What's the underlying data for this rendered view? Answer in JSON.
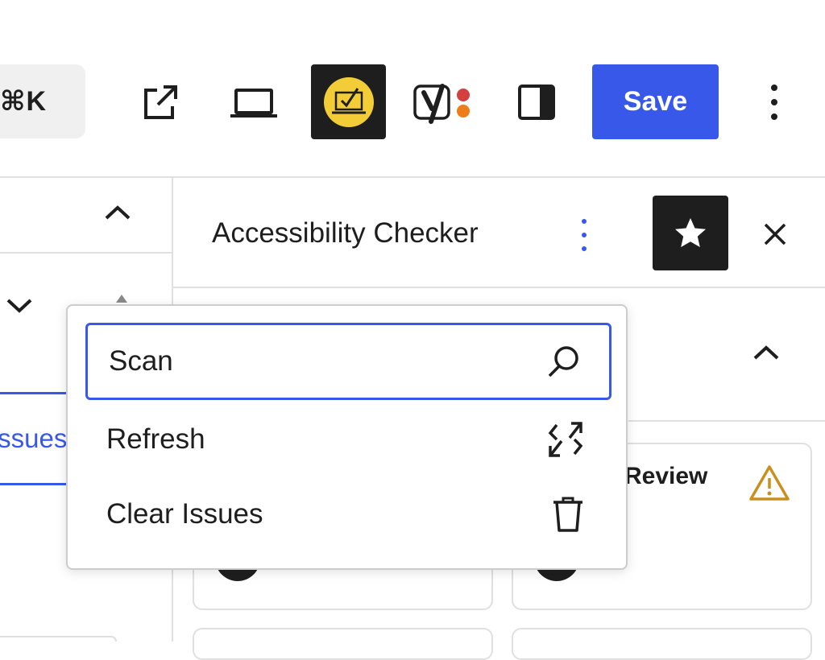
{
  "toolbar": {
    "shortcut_label": "⌘K",
    "save_label": "Save",
    "icons": {
      "view_post": "external-link-icon",
      "preview_device": "laptop-icon",
      "accessibility_checker": "accessibility-checker-icon",
      "yoast": "yoast-seo-icon",
      "settings": "sidebar-toggle-icon",
      "options": "more-vertical-icon"
    }
  },
  "sidebar": {
    "title": "Accessibility Checker",
    "icons": {
      "panel_menu": "more-vertical-icon",
      "pin": "star-icon",
      "close": "close-icon"
    }
  },
  "left_panel": {
    "active_tab_label": "Issues"
  },
  "cards": {
    "review_label": "Review"
  },
  "dropdown_menu": {
    "items": [
      {
        "label": "Scan",
        "icon": "search-icon"
      },
      {
        "label": "Refresh",
        "icon": "refresh-icon"
      },
      {
        "label": "Clear Issues",
        "icon": "trash-icon"
      }
    ]
  },
  "colors": {
    "accent": "#3858e9",
    "dark": "#1e1e1e",
    "a11y_badge": "#f3cd38",
    "warning": "#b26200",
    "yoast_red": "#d43f3f",
    "yoast_orange": "#ee7c1b"
  }
}
